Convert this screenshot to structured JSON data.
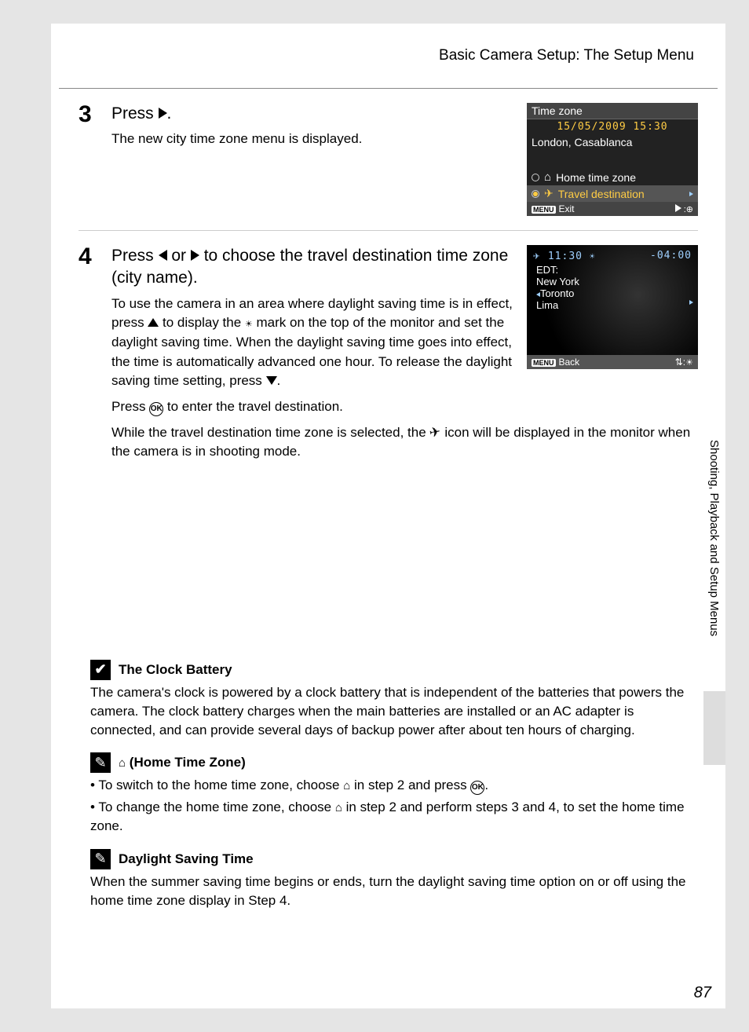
{
  "breadcrumb": "Basic Camera Setup: The Setup Menu",
  "step3": {
    "num": "3",
    "title_pre": "Press ",
    "title_post": ".",
    "body": "The new city time zone menu is displayed.",
    "lcd": {
      "title": "Time zone",
      "datetime": "15/05/2009  15:30",
      "city": "London, Casablanca",
      "home_label": "Home time zone",
      "travel_label": "Travel destination",
      "exit": "Exit"
    }
  },
  "step4": {
    "num": "4",
    "title_p1": "Press ",
    "title_p2": " or ",
    "title_p3": " to choose the travel destination time zone (city name).",
    "para1_a": "To use the camera in an area where daylight saving time is in effect, press ",
    "para1_b": " to display the ",
    "para1_c": " mark on the top of the monitor and set the daylight saving time. When the daylight saving time goes into effect, the time is automatically advanced one hour. To release the daylight saving time setting, press ",
    "para1_d": ".",
    "para2_a": "Press ",
    "para2_b": " to enter the travel destination.",
    "para3_a": "While the travel destination time zone is selected, the ",
    "para3_b": " icon will be displayed in the monitor when the camera is in shooting mode.",
    "lcd": {
      "time": "11:30",
      "offset": "-04:00",
      "tzname": "EDT:",
      "city1": "New York",
      "city2": "Toronto",
      "city3": "Lima",
      "back": "Back"
    }
  },
  "notes": {
    "clock_title": "The Clock Battery",
    "clock_text": "The camera's clock is powered by a clock battery that is independent of the batteries that powers the camera. The clock battery charges when the main batteries are installed or an AC adapter is connected, and can provide several days of backup power after about ten hours of charging.",
    "home_title": " (Home Time Zone)",
    "home_li1_a": "To switch to the home time zone, choose ",
    "home_li1_b": " in step 2 and press ",
    "home_li1_c": ".",
    "home_li2_a": "To change the home time zone, choose ",
    "home_li2_b": " in step 2 and perform steps 3 and 4, to set the home time zone.",
    "dst_title": "Daylight Saving Time",
    "dst_text": "When the summer saving time begins or ends, turn the daylight saving time option on or off using the home time zone display in Step 4."
  },
  "side_tab": "Shooting, Playback and Setup Menus",
  "page_number": "87"
}
